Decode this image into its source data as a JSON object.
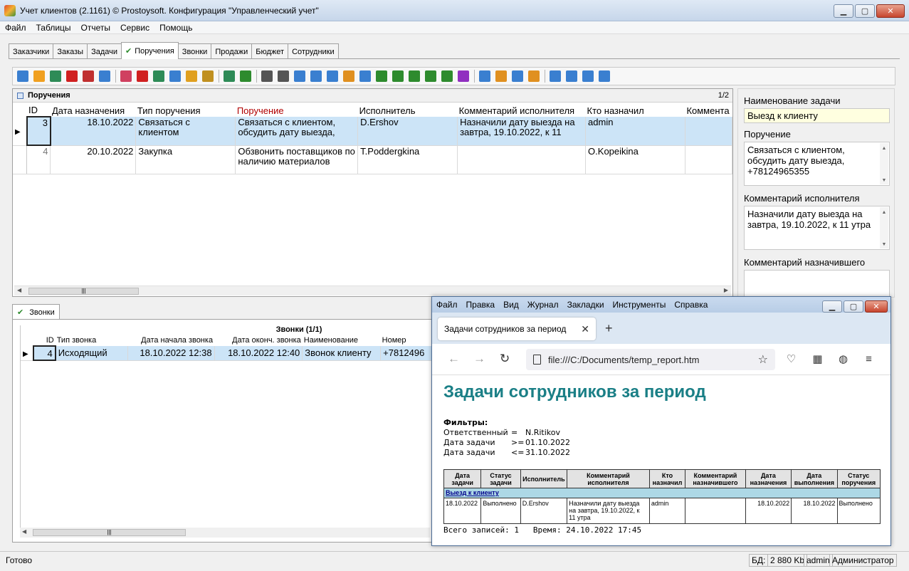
{
  "window": {
    "title": "Учет клиентов (2.1161) © Prostoysoft. Конфигурация \"Управленческий учет\""
  },
  "menu": [
    "Файл",
    "Таблицы",
    "Отчеты",
    "Сервис",
    "Помощь"
  ],
  "tabs": [
    "Заказчики",
    "Заказы",
    "Задачи",
    "Поручения",
    "Звонки",
    "Продажи",
    "Бюджет",
    "Сотрудники"
  ],
  "orders_panel": {
    "title": "Поручения",
    "page": "1/2",
    "columns": [
      "ID",
      "Дата назначения",
      "Тип поручения",
      "Поручение",
      "Исполнитель",
      "Комментарий исполнителя",
      "Кто назначил",
      "Коммента"
    ],
    "rows": [
      {
        "id": "3",
        "date": "18.10.2022",
        "type": "Связаться с клиентом",
        "task": "Связаться с клиентом, обсудить дату выезда,",
        "executor": "D.Ershov",
        "comment": "Назначили дату выезда на завтра, 19.10.2022, к 11",
        "assigner": "admin",
        "extra": ""
      },
      {
        "id": "4",
        "date": "20.10.2022",
        "type": "Закупка",
        "task": "Обзвонить поставщиков по наличию материалов",
        "executor": "T.Poddergkina",
        "comment": "",
        "assigner": "O.Kopeikina",
        "extra": ""
      }
    ]
  },
  "details": {
    "task_name_label": "Наименование задачи",
    "task_name": "Выезд к клиенту",
    "order_label": "Поручение",
    "order_text": "Связаться с клиентом, обсудить дату выезда, +78124965355",
    "exec_comment_label": "Комментарий исполнителя",
    "exec_comment": "Назначили дату выезда на завтра, 19.10.2022, к 11 утра",
    "assigner_comment_label": "Комментарий назначившего",
    "assigner_comment": ""
  },
  "calls": {
    "tab": "Звонки",
    "caption": "Звонки (1/1)",
    "columns": [
      "ID",
      "Тип звонка",
      "Дата начала звонка",
      "Дата оконч. звонка",
      "Наименование",
      "Номер"
    ],
    "rows": [
      {
        "id": "4",
        "type": "Исходящий",
        "start": "18.10.2022 12:38",
        "end": "18.10.2022 12:40",
        "name": "Звонок клиенту",
        "number": "+7812496"
      }
    ]
  },
  "status": {
    "ready": "Готово",
    "db_label": "БД:",
    "db_size": "2 880 Kb",
    "user": "admin",
    "role": "Администратор"
  },
  "browser": {
    "menu": [
      "Файл",
      "Правка",
      "Вид",
      "Журнал",
      "Закладки",
      "Инструменты",
      "Справка"
    ],
    "tab_title": "Задачи сотрудников за период",
    "url": "file:///C:/Documents/temp_report.htm",
    "report": {
      "title": "Задачи сотрудников за период",
      "filters_label": "Фильтры:",
      "filters": [
        {
          "k": "Ответственный",
          "op": "=",
          "v": "N.Ritikov"
        },
        {
          "k": "Дата задачи",
          "op": ">=",
          "v": "01.10.2022"
        },
        {
          "k": "Дата задачи",
          "op": "<=",
          "v": "31.10.2022"
        }
      ],
      "columns": [
        "Дата задачи",
        "Статус задачи",
        "Исполнитель",
        "Комментарий исполнителя",
        "Кто назначил",
        "Комментарий назначившего",
        "Дата назначения",
        "Дата выполнения",
        "Статус поручения"
      ],
      "group": "Выезд к клиенту",
      "row": [
        "18.10.2022",
        "Выполнено",
        "D.Ershov",
        "Назначили дату выезда на завтра, 19.10.2022, к 11 утра",
        "admin",
        "",
        "18.10.2022",
        "18.10.2022",
        "Выполнено"
      ],
      "total": "Всего записей: 1",
      "time": "Время: 24.10.2022 17:45"
    }
  },
  "toolbar_icon_colors": [
    "#3a7fd0",
    "#f0a020",
    "#2e8b57",
    "#d02020",
    "#c03030",
    "#3a7fd0",
    "#d04060",
    "#d02020",
    "#2e8b57",
    "#3a7fd0",
    "#e0a020",
    "#c09020",
    "#2e8b57",
    "#2e8b2e",
    "#555555",
    "#555555",
    "#3a7fd0",
    "#3a7fd0",
    "#3a7fd0",
    "#e09020",
    "#3a7fd0",
    "#2e8b2e",
    "#2e8b2e",
    "#2e8b2e",
    "#2e8b2e",
    "#2e8b2e",
    "#9030c0",
    "#3a7fd0",
    "#e09020",
    "#3a7fd0",
    "#e09020",
    "#3a7fd0",
    "#3a7fd0",
    "#3a7fd0",
    "#3a7fd0"
  ]
}
